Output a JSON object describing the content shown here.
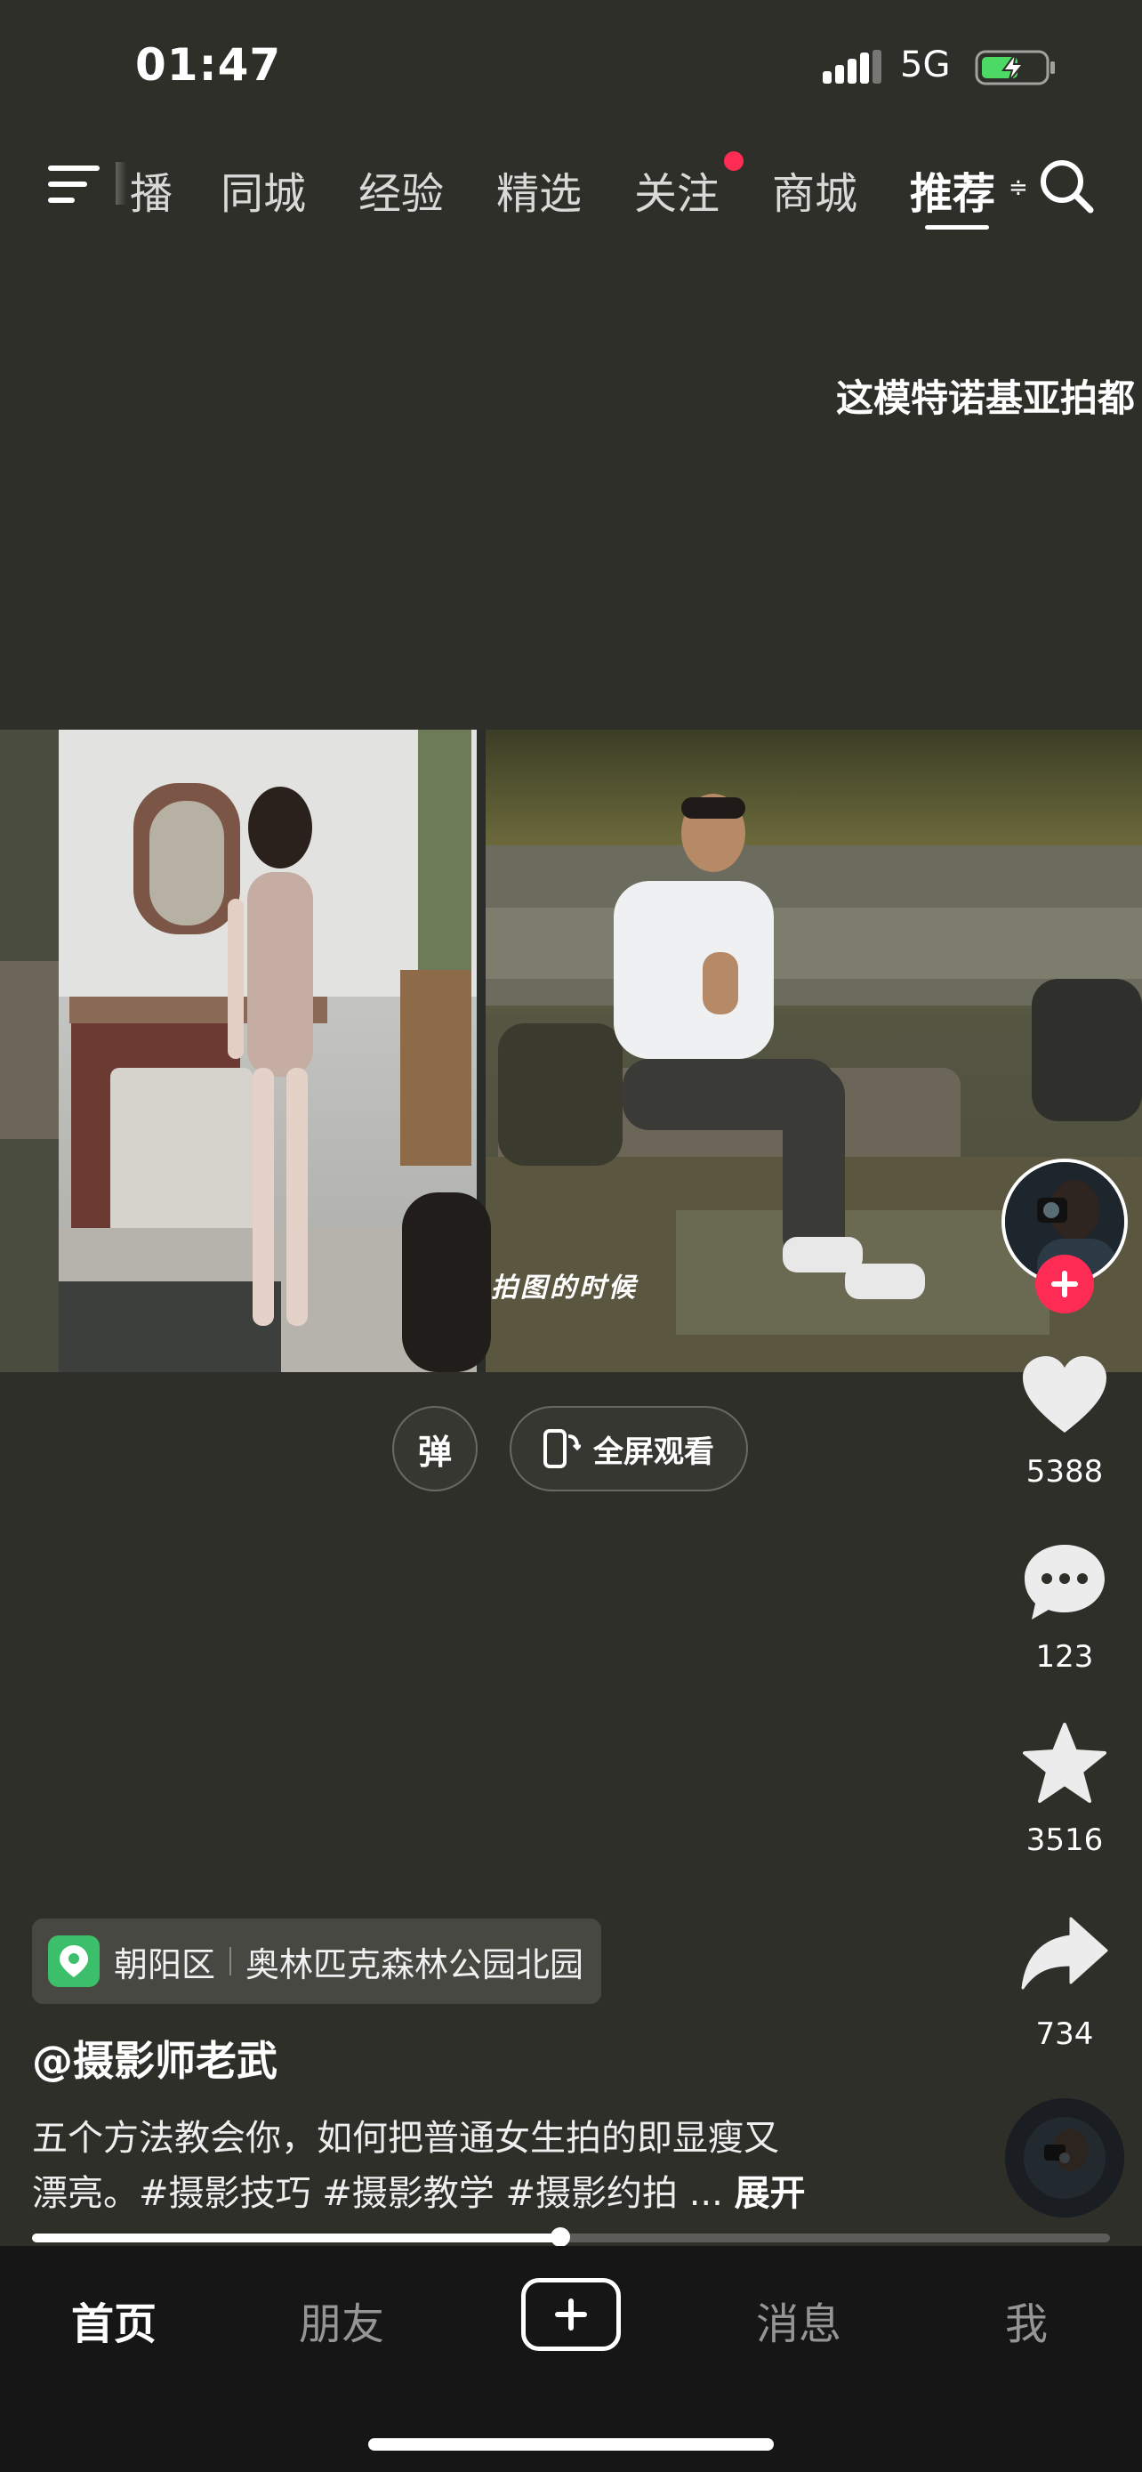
{
  "status_bar": {
    "time": "01:47",
    "network": "5G",
    "battery_charging": true
  },
  "top_nav": {
    "tabs": [
      {
        "label": "播",
        "active": false
      },
      {
        "label": "同城",
        "active": false
      },
      {
        "label": "经验",
        "active": false
      },
      {
        "label": "精选",
        "active": false
      },
      {
        "label": "关注",
        "active": false,
        "has_dot": true
      },
      {
        "label": "商城",
        "active": false
      },
      {
        "label": "推荐",
        "active": true
      }
    ],
    "icons": {
      "menu": "menu-icon",
      "search": "search-icon"
    },
    "accent_color": "#fe2c55"
  },
  "marquee_text": "这模特诺基亚拍都",
  "video": {
    "overlay_caption": "拍图的时候",
    "controls": {
      "danmaku_label": "弹",
      "fullscreen_label": "全屏观看"
    },
    "progress": 0.49
  },
  "right_rail": {
    "likes": "5388",
    "comments": "123",
    "favorites": "3516",
    "shares": "734"
  },
  "info": {
    "location_district": "朝阳区",
    "location_place": "奥林匹克森林公园北园",
    "author": "@摄影师老武",
    "caption_line1": "五个方法教会你，如何把普通女生拍的即显瘦又",
    "caption_line2": "漂亮。#摄影技巧 #摄影教学 #摄影约拍 ...",
    "expand_label": "展开"
  },
  "bottom_tabs": {
    "home": "首页",
    "friends": "朋友",
    "messages": "消息",
    "me": "我"
  },
  "colors": {
    "background": "#2f2f2a",
    "tabbar": "#161616",
    "location_green": "#3cbf6b"
  }
}
